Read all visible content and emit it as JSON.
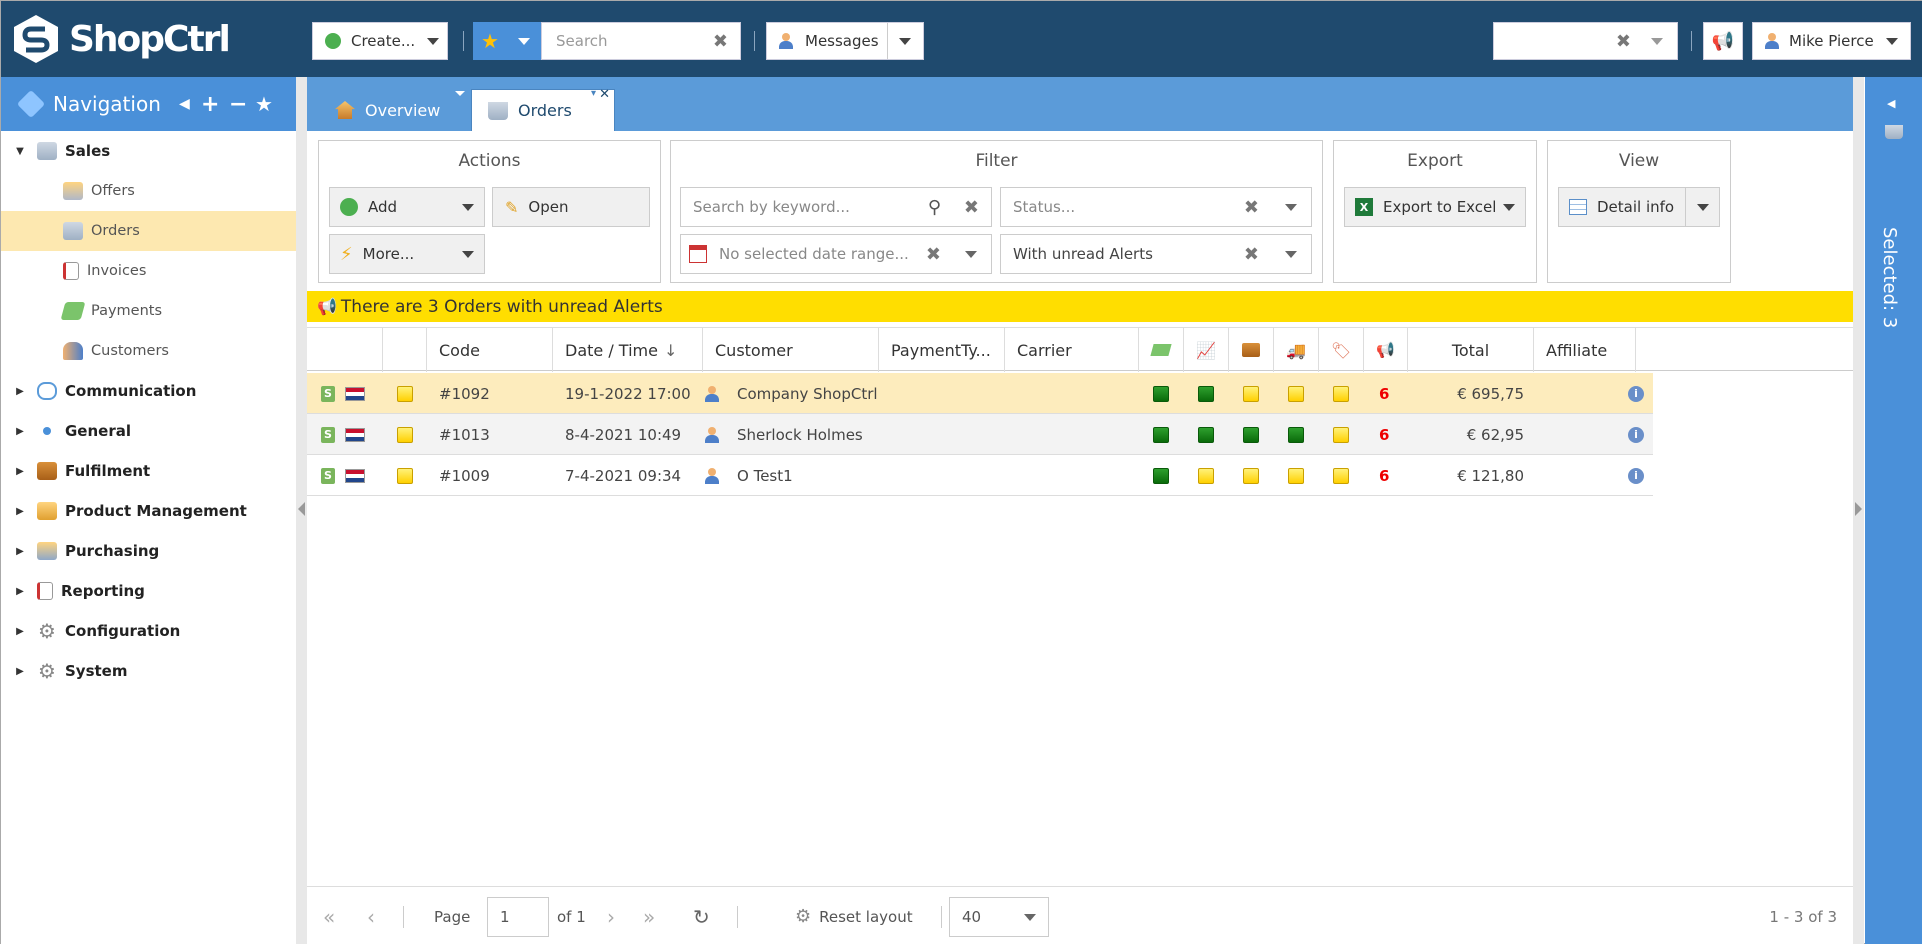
{
  "app": {
    "name": "ShopCtrl"
  },
  "topbar": {
    "create_label": "Create...",
    "search_placeholder": "Search",
    "messages_label": "Messages",
    "user_name": "Mike Pierce"
  },
  "nav": {
    "title": "Navigation",
    "items": [
      {
        "label": "Sales",
        "level": "top",
        "expanded": true,
        "icon": "sales-basket-icon"
      },
      {
        "label": "Offers",
        "level": "sub",
        "icon": "offers-basket-icon"
      },
      {
        "label": "Orders",
        "level": "sub",
        "selected": true,
        "icon": "orders-basket-icon"
      },
      {
        "label": "Invoices",
        "level": "sub",
        "icon": "invoice-icon"
      },
      {
        "label": "Payments",
        "level": "sub",
        "icon": "money-icon"
      },
      {
        "label": "Customers",
        "level": "sub",
        "icon": "customers-icon"
      },
      {
        "label": "Communication",
        "level": "top",
        "icon": "speech-bubbles-icon"
      },
      {
        "label": "General",
        "level": "top",
        "icon": "dot-icon"
      },
      {
        "label": "Fulfilment",
        "level": "top",
        "icon": "box-icon"
      },
      {
        "label": "Product Management",
        "level": "top",
        "icon": "package-icon"
      },
      {
        "label": "Purchasing",
        "level": "top",
        "icon": "purchasing-icon"
      },
      {
        "label": "Reporting",
        "level": "top",
        "icon": "report-icon"
      },
      {
        "label": "Configuration",
        "level": "top",
        "icon": "gear-icon"
      },
      {
        "label": "System",
        "level": "top",
        "icon": "gear-icon"
      }
    ]
  },
  "tabs": {
    "overview": "Overview",
    "orders": "Orders"
  },
  "panels": {
    "actions": {
      "title": "Actions",
      "add": "Add",
      "open": "Open",
      "more": "More..."
    },
    "filter": {
      "title": "Filter",
      "keyword_placeholder": "Search by keyword...",
      "status_placeholder": "Status...",
      "date_placeholder": "No selected date range...",
      "alerts_value": "With unread Alerts"
    },
    "export": {
      "title": "Export",
      "excel": "Export to Excel"
    },
    "view": {
      "title": "View",
      "detail": "Detail info"
    }
  },
  "alert_message": "There are 3 Orders with unread Alerts",
  "grid": {
    "headers": {
      "code": "Code",
      "date": "Date / Time",
      "customer": "Customer",
      "payment": "PaymentTy...",
      "carrier": "Carrier",
      "total": "Total",
      "affiliate": "Affiliate"
    },
    "rows": [
      {
        "code": "#1092",
        "date": "19-1-2022 17:00",
        "customer": "Company ShopCtrl",
        "status": [
          "green",
          "green",
          "yellow",
          "yellow",
          "yellow"
        ],
        "alerts": "6",
        "total": "€ 695,75"
      },
      {
        "code": "#1013",
        "date": "8-4-2021 10:49",
        "customer": "Sherlock Holmes",
        "status": [
          "green",
          "green",
          "green",
          "green",
          "yellow"
        ],
        "alerts": "6",
        "total": "€ 62,95"
      },
      {
        "code": "#1009",
        "date": "7-4-2021 09:34",
        "customer": "O Test1",
        "status": [
          "green",
          "yellow",
          "yellow",
          "yellow",
          "yellow"
        ],
        "alerts": "6",
        "total": "€ 121,80"
      }
    ]
  },
  "pager": {
    "page_label": "Page",
    "page_value": "1",
    "of_label": "of 1",
    "reset_label": "Reset layout",
    "page_size": "40",
    "summary": "1 - 3 of 3"
  },
  "selected_panel": "Selected: 3",
  "colors": {
    "topbar": "#1f4a6e",
    "accent": "#4a90d9",
    "alert": "#ffde00",
    "selected_row": "#fdecbd"
  }
}
